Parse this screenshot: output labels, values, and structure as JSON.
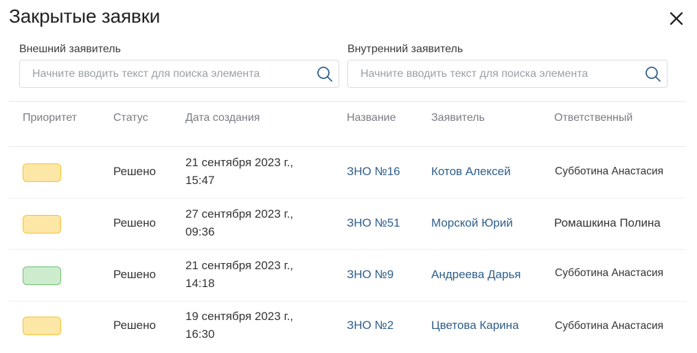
{
  "header": {
    "title": "Закрытые заявки"
  },
  "filters": {
    "external": {
      "label": "Внешний заявитель",
      "placeholder": "Начните вводить текст для поиска элемента"
    },
    "internal": {
      "label": "Внутренний заявитель",
      "placeholder": "Начните вводить текст для поиска элемента"
    }
  },
  "table": {
    "columns": {
      "priority": "Приоритет",
      "status": "Статус",
      "created": "Дата создания",
      "name": "Название",
      "requester": "Заявитель",
      "responsible": "Ответственный"
    },
    "rows": [
      {
        "priority_color": "#fde7a6",
        "priority_border": "#f2c230",
        "status": "Решено",
        "date_line1": "21 сентября 2023 г.,",
        "date_line2": "15:47",
        "name": "ЗНО №16",
        "requester": "Котов Алексей",
        "responsible": "Субботина Анастасия"
      },
      {
        "priority_color": "#fde7a6",
        "priority_border": "#f2c230",
        "status": "Решено",
        "date_line1": "27 сентября 2023 г.,",
        "date_line2": "09:36",
        "name": "ЗНО №51",
        "requester": "Морской Юрий",
        "responsible": "Ромашкина Полина"
      },
      {
        "priority_color": "#cdeccd",
        "priority_border": "#6cc070",
        "status": "Решено",
        "date_line1": "21 сентября 2023 г.,",
        "date_line2": "14:18",
        "name": "ЗНО №9",
        "requester": "Андреева Дарья",
        "responsible": "Субботина Анастасия"
      },
      {
        "priority_color": "#fde7a6",
        "priority_border": "#f2c230",
        "status": "Решено",
        "date_line1": "19 сентября 2023 г.,",
        "date_line2": "16:30",
        "name": "ЗНО №2",
        "requester": "Цветова Карина",
        "responsible": "Субботина Анастасия"
      }
    ]
  },
  "icons": {
    "close": "close-icon",
    "search": "search-icon"
  },
  "colors": {
    "link": "#2d5d8a",
    "accent": "#2d5d8a"
  }
}
